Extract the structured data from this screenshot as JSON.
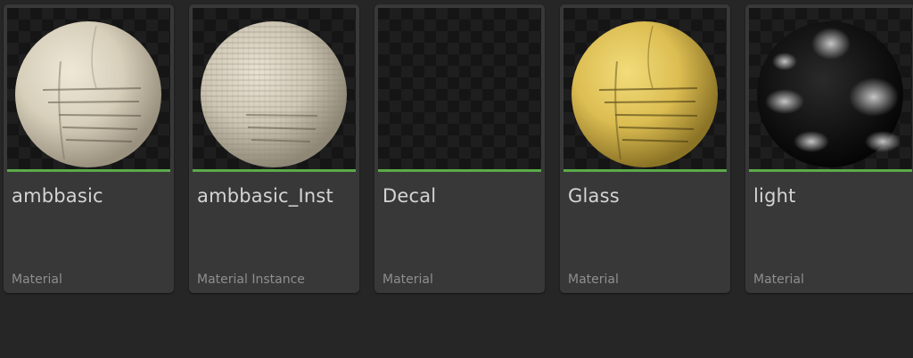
{
  "colors": {
    "background": "#262626",
    "tile": "#383838",
    "accent": "#5aaa4a"
  },
  "assets": [
    {
      "name": "ambbasic",
      "type": "Material",
      "preview": "sphere-cream-stitched"
    },
    {
      "name": "ambbasic_Inst",
      "type": "Material Instance",
      "preview": "sphere-cream-grid"
    },
    {
      "name": "Decal",
      "type": "Material",
      "preview": "empty"
    },
    {
      "name": "Glass",
      "type": "Material",
      "preview": "sphere-yellow-stitched"
    },
    {
      "name": "light",
      "type": "Material",
      "preview": "sphere-dark-reflective"
    }
  ]
}
